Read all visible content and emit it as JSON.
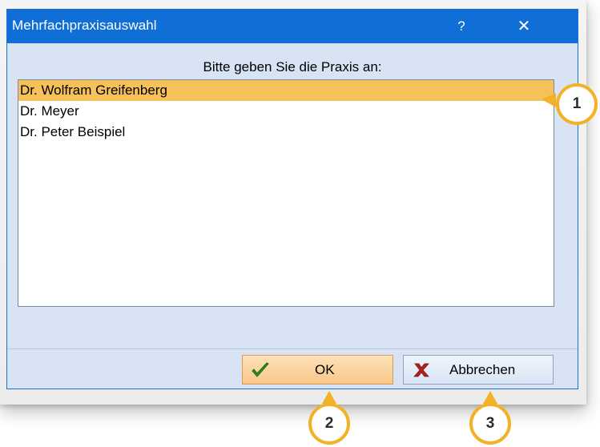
{
  "window": {
    "title": "Mehrfachpraxisauswahl",
    "help_label": "?",
    "close_label": "✕"
  },
  "prompt": "Bitte geben Sie die Praxis an:",
  "list": {
    "items": [
      {
        "label": "Dr. Wolfram Greifenberg",
        "selected": true
      },
      {
        "label": "Dr. Meyer",
        "selected": false
      },
      {
        "label": "Dr. Peter Beispiel",
        "selected": false
      }
    ]
  },
  "buttons": {
    "ok_label": "OK",
    "cancel_label": "Abbrechen"
  },
  "callouts": {
    "one": "1",
    "two": "2",
    "three": "3"
  },
  "colors": {
    "titlebar": "#0f6fd6",
    "selection": "#f7c15a",
    "callout_border": "#f3b128",
    "ok_check": "#2f8f1e",
    "cancel_x": "#b3201c"
  },
  "icons": {
    "ok": "check-icon",
    "cancel": "x-icon"
  }
}
